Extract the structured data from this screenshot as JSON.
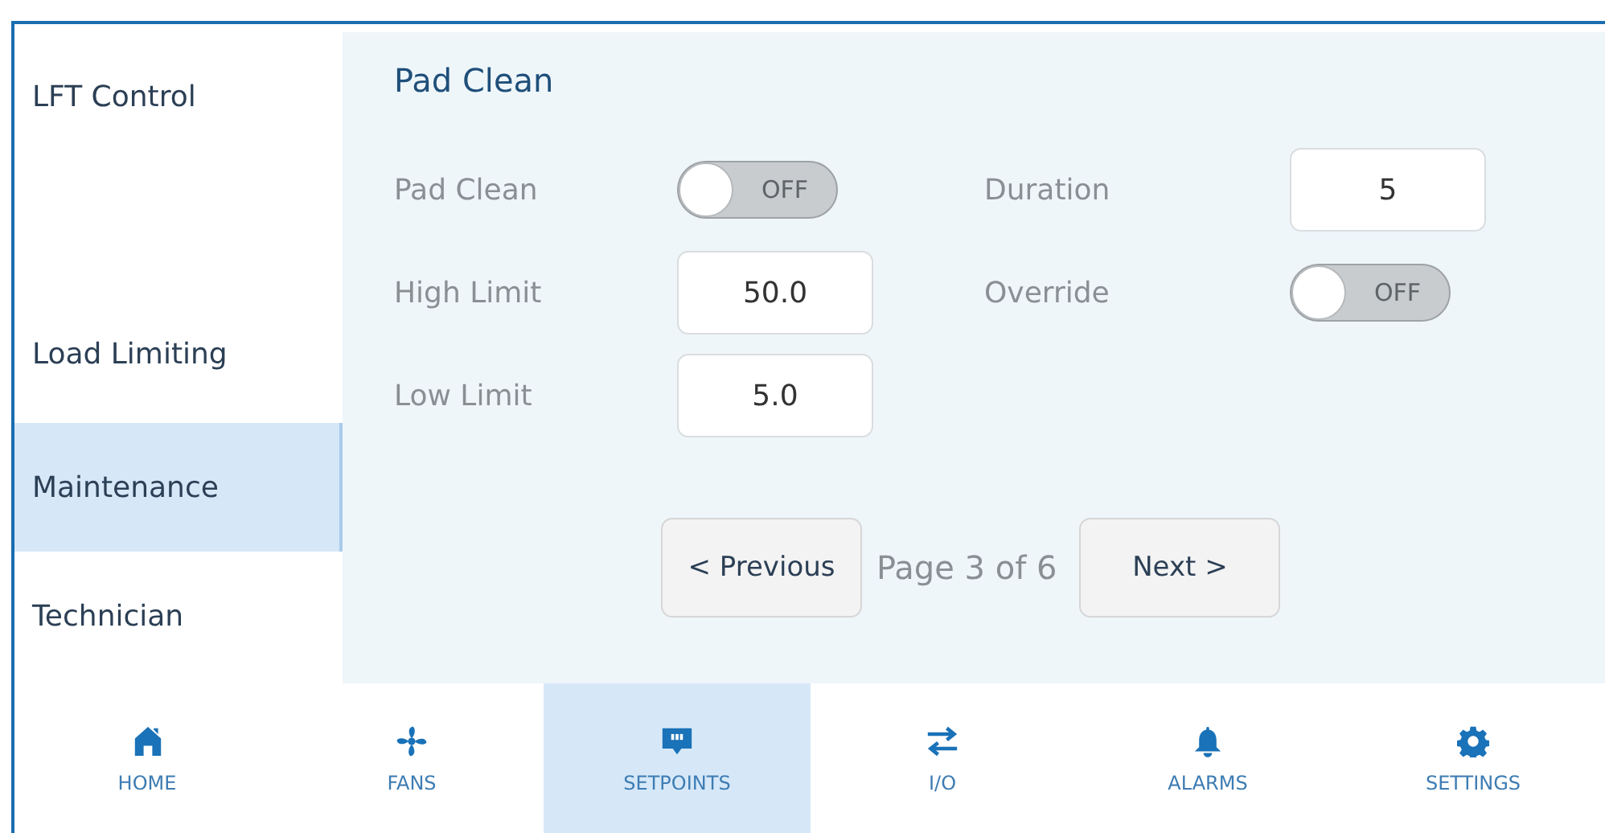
{
  "sidebar": {
    "items": [
      {
        "label": "LFT Control",
        "selected": false
      },
      {
        "label": "Load Limiting",
        "selected": false
      },
      {
        "label": "Maintenance",
        "selected": true
      },
      {
        "label": "Technician",
        "selected": false
      }
    ]
  },
  "panel": {
    "title": "Pad Clean",
    "left": [
      {
        "kind": "switch",
        "label": "Pad Clean",
        "on": false,
        "text": "OFF"
      },
      {
        "kind": "field",
        "label": "High Limit",
        "value": "50.0"
      },
      {
        "kind": "field",
        "label": "Low Limit",
        "value": "5.0"
      }
    ],
    "right": [
      {
        "kind": "field",
        "label": "Duration",
        "value": "5"
      },
      {
        "kind": "switch",
        "label": "Override",
        "on": false,
        "text": "OFF"
      }
    ]
  },
  "pager": {
    "previous": "< Previous",
    "page": "Page 3 of 6",
    "next": "Next >"
  },
  "nav": [
    {
      "kind": "home",
      "label": "HOME",
      "selected": false
    },
    {
      "kind": "fan",
      "label": "FANS",
      "selected": false
    },
    {
      "kind": "setpoints",
      "label": "SETPOINTS",
      "selected": true
    },
    {
      "kind": "io",
      "label": "I/O",
      "selected": false
    },
    {
      "kind": "bell",
      "label": "ALARMS",
      "selected": false
    },
    {
      "kind": "gear",
      "label": "SETTINGS",
      "selected": false
    }
  ]
}
